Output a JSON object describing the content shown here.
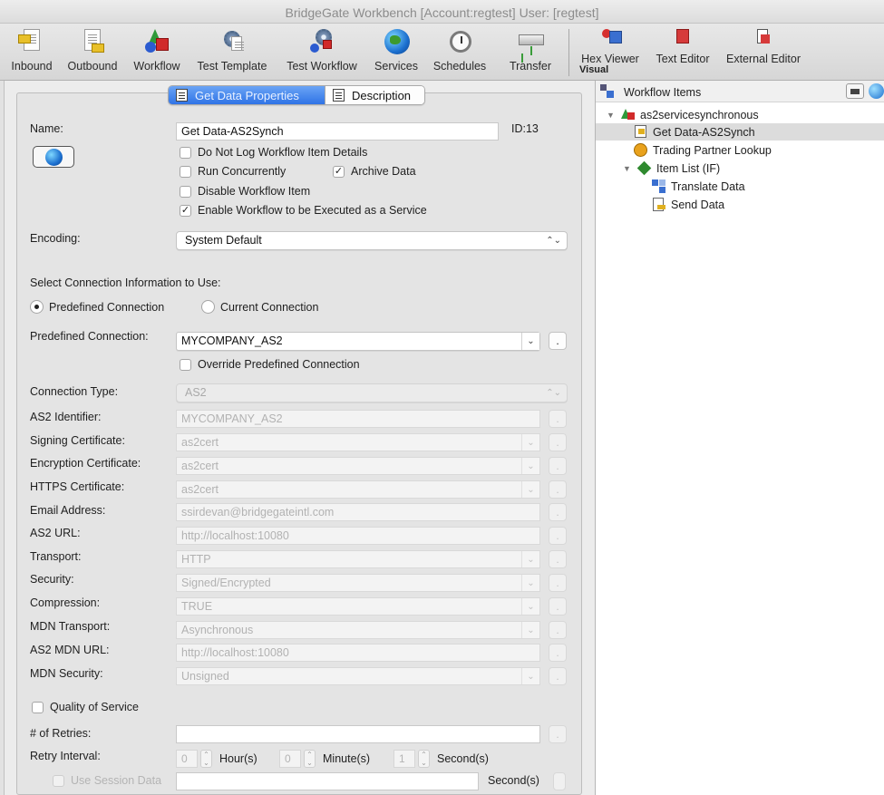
{
  "window": {
    "title": "BridgeGate Workbench [Account:regtest] User: [regtest]"
  },
  "toolbar": {
    "items": [
      {
        "label": "Inbound",
        "icon": "inbound-icon"
      },
      {
        "label": "Outbound",
        "icon": "outbound-icon"
      },
      {
        "label": "Workflow",
        "icon": "workflow-icon"
      },
      {
        "label": "Test Template",
        "icon": "test-template-icon"
      },
      {
        "label": "Test Workflow",
        "icon": "test-workflow-icon"
      },
      {
        "label": "Services",
        "icon": "globe-icon"
      },
      {
        "label": "Schedules",
        "icon": "clock-icon"
      },
      {
        "label": "Transfer",
        "icon": "server-icon"
      },
      {
        "label": "Hex Viewer",
        "icon": "hex-viewer-icon"
      },
      {
        "label": "Text Editor",
        "icon": "text-editor-icon"
      },
      {
        "label": "External Editor",
        "icon": "external-editor-icon"
      }
    ],
    "group_label": "Visual"
  },
  "tabs": {
    "active": "Get Data Properties",
    "other": "Description"
  },
  "form": {
    "name_label": "Name:",
    "name_value": "Get Data-AS2Synch",
    "id_label": "ID:13",
    "checks": {
      "no_log": "Do Not Log Workflow Item Details",
      "run_concurrently": "Run Concurrently",
      "archive": "Archive Data",
      "disable": "Disable Workflow Item",
      "enable_service": "Enable Workflow to be Executed as a Service"
    },
    "encoding_label": "Encoding:",
    "encoding_value": "System Default",
    "conn_info_label": "Select Connection Information to Use:",
    "radio_predefined": "Predefined Connection",
    "radio_current": "Current Connection",
    "predef_label": "Predefined Connection:",
    "predef_value": "MYCOMPANY_AS2",
    "override_label": "Override Predefined Connection",
    "conn_type_label": "Connection Type:",
    "conn_type_value": "AS2",
    "rows": [
      {
        "label": "AS2 Identifier:",
        "value": "MYCOMPANY_AS2",
        "kind": "text"
      },
      {
        "label": "Signing Certificate:",
        "value": "as2cert",
        "kind": "combo"
      },
      {
        "label": "Encryption Certificate:",
        "value": "as2cert",
        "kind": "combo"
      },
      {
        "label": "HTTPS Certificate:",
        "value": "as2cert",
        "kind": "combo"
      },
      {
        "label": "Email Address:",
        "value": "ssirdevan@bridgegateintl.com",
        "kind": "text"
      },
      {
        "label": "AS2 URL:",
        "value": "http://localhost:10080",
        "kind": "text"
      },
      {
        "label": "Transport:",
        "value": "HTTP",
        "kind": "combo"
      },
      {
        "label": "Security:",
        "value": "Signed/Encrypted",
        "kind": "combo"
      },
      {
        "label": "Compression:",
        "value": "TRUE",
        "kind": "combo"
      },
      {
        "label": "MDN Transport:",
        "value": "Asynchronous",
        "kind": "combo"
      },
      {
        "label": "AS2 MDN URL:",
        "value": "http://localhost:10080",
        "kind": "text"
      },
      {
        "label": "MDN Security:",
        "value": "Unsigned",
        "kind": "combo"
      }
    ],
    "qos_label": "Quality of Service",
    "retries_label": "# of Retries:",
    "retry_interval_label": "Retry Interval:",
    "hours_value": "0",
    "hours_unit": "Hour(s)",
    "minutes_value": "0",
    "minutes_unit": "Minute(s)",
    "seconds_value": "1",
    "seconds_unit": "Second(s)",
    "session_label": "Use Session Data",
    "session_unit": "Second(s)",
    "dots": "."
  },
  "workflow_items": {
    "title": "Workflow Items",
    "tree": [
      {
        "label": "as2servicesynchronous",
        "icon": "workflow-icon"
      },
      {
        "label": "Get Data-AS2Synch",
        "icon": "get-data-icon"
      },
      {
        "label": "Trading Partner Lookup",
        "icon": "trading-partner-icon"
      },
      {
        "label": "Item List (IF)",
        "icon": "if-icon"
      },
      {
        "label": "Translate Data",
        "icon": "translate-icon"
      },
      {
        "label": "Send Data",
        "icon": "send-data-icon"
      }
    ]
  }
}
